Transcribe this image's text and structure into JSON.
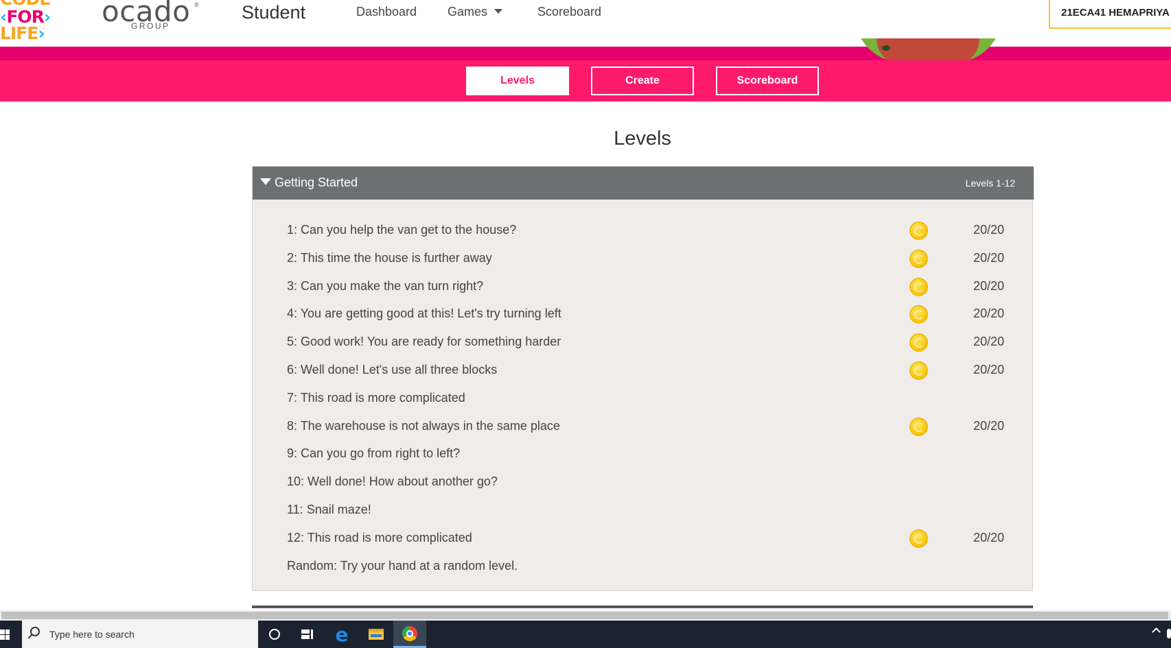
{
  "header": {
    "logo_lines": [
      "CODE",
      "FOR",
      "LIFE"
    ],
    "brand": "ocado",
    "brand_sub": "GROUP",
    "brand_mark": "®",
    "section": "Student",
    "nav": [
      {
        "label": "Dashboard"
      },
      {
        "label": "Games"
      },
      {
        "label": "Scoreboard"
      }
    ],
    "user": "21ECA41 HEMAPRIYA"
  },
  "subnav": {
    "tabs": [
      {
        "label": "Levels",
        "active": true
      },
      {
        "label": "Create",
        "active": false
      },
      {
        "label": "Scoreboard",
        "active": false
      }
    ]
  },
  "page": {
    "title": "Levels"
  },
  "episode": {
    "name": "Getting Started",
    "range": "Levels 1-12",
    "levels": [
      {
        "label": "1: Can you help the van get to the house?",
        "score": "20/20",
        "coin": true
      },
      {
        "label": "2: This time the house is further away",
        "score": "20/20",
        "coin": true
      },
      {
        "label": "3: Can you make the van turn right?",
        "score": "20/20",
        "coin": true
      },
      {
        "label": "4: You are getting good at this! Let's try turning left",
        "score": "20/20",
        "coin": true
      },
      {
        "label": "5: Good work! You are ready for something harder",
        "score": "20/20",
        "coin": true
      },
      {
        "label": "6: Well done! Let's use all three blocks",
        "score": "20/20",
        "coin": true
      },
      {
        "label": "7: This road is more complicated",
        "score": "",
        "coin": false
      },
      {
        "label": "8: The warehouse is not always in the same place",
        "score": "20/20",
        "coin": true
      },
      {
        "label": "9: Can you go from right to left?",
        "score": "",
        "coin": false
      },
      {
        "label": "10: Well done! How about another go?",
        "score": "",
        "coin": false
      },
      {
        "label": "11: Snail maze!",
        "score": "",
        "coin": false
      },
      {
        "label": "12: This road is more complicated",
        "score": "20/20",
        "coin": true
      },
      {
        "label": "Random: Try your hand at a random level.",
        "score": "",
        "coin": false
      }
    ]
  },
  "taskbar": {
    "search_placeholder": "Type here to search",
    "icons": [
      "windows-start-icon",
      "search-icon",
      "cortana-icon",
      "task-view-icon",
      "edge-icon",
      "file-explorer-icon",
      "chrome-icon"
    ]
  },
  "colors": {
    "brand_pink": "#fe1a6b",
    "brand_pink_dark": "#e6006e",
    "header_gray": "#6c7071",
    "panel_bg": "#efecea",
    "coin_gold": "#f8c914",
    "user_border": "#f4c431"
  }
}
